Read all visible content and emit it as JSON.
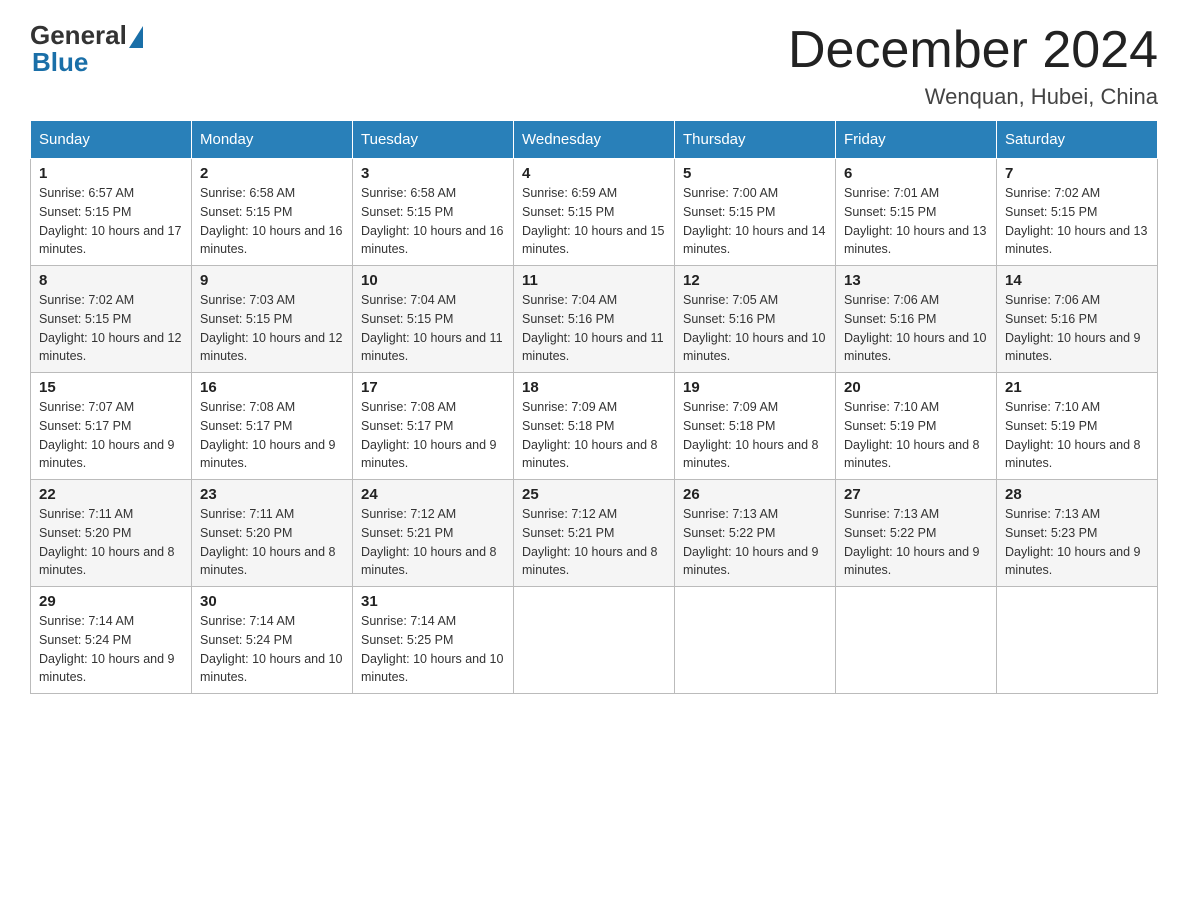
{
  "logo": {
    "general": "General",
    "blue": "Blue"
  },
  "title": "December 2024",
  "location": "Wenquan, Hubei, China",
  "days_of_week": [
    "Sunday",
    "Monday",
    "Tuesday",
    "Wednesday",
    "Thursday",
    "Friday",
    "Saturday"
  ],
  "weeks": [
    [
      {
        "day": "1",
        "sunrise": "6:57 AM",
        "sunset": "5:15 PM",
        "daylight": "10 hours and 17 minutes."
      },
      {
        "day": "2",
        "sunrise": "6:58 AM",
        "sunset": "5:15 PM",
        "daylight": "10 hours and 16 minutes."
      },
      {
        "day": "3",
        "sunrise": "6:58 AM",
        "sunset": "5:15 PM",
        "daylight": "10 hours and 16 minutes."
      },
      {
        "day": "4",
        "sunrise": "6:59 AM",
        "sunset": "5:15 PM",
        "daylight": "10 hours and 15 minutes."
      },
      {
        "day": "5",
        "sunrise": "7:00 AM",
        "sunset": "5:15 PM",
        "daylight": "10 hours and 14 minutes."
      },
      {
        "day": "6",
        "sunrise": "7:01 AM",
        "sunset": "5:15 PM",
        "daylight": "10 hours and 13 minutes."
      },
      {
        "day": "7",
        "sunrise": "7:02 AM",
        "sunset": "5:15 PM",
        "daylight": "10 hours and 13 minutes."
      }
    ],
    [
      {
        "day": "8",
        "sunrise": "7:02 AM",
        "sunset": "5:15 PM",
        "daylight": "10 hours and 12 minutes."
      },
      {
        "day": "9",
        "sunrise": "7:03 AM",
        "sunset": "5:15 PM",
        "daylight": "10 hours and 12 minutes."
      },
      {
        "day": "10",
        "sunrise": "7:04 AM",
        "sunset": "5:15 PM",
        "daylight": "10 hours and 11 minutes."
      },
      {
        "day": "11",
        "sunrise": "7:04 AM",
        "sunset": "5:16 PM",
        "daylight": "10 hours and 11 minutes."
      },
      {
        "day": "12",
        "sunrise": "7:05 AM",
        "sunset": "5:16 PM",
        "daylight": "10 hours and 10 minutes."
      },
      {
        "day": "13",
        "sunrise": "7:06 AM",
        "sunset": "5:16 PM",
        "daylight": "10 hours and 10 minutes."
      },
      {
        "day": "14",
        "sunrise": "7:06 AM",
        "sunset": "5:16 PM",
        "daylight": "10 hours and 9 minutes."
      }
    ],
    [
      {
        "day": "15",
        "sunrise": "7:07 AM",
        "sunset": "5:17 PM",
        "daylight": "10 hours and 9 minutes."
      },
      {
        "day": "16",
        "sunrise": "7:08 AM",
        "sunset": "5:17 PM",
        "daylight": "10 hours and 9 minutes."
      },
      {
        "day": "17",
        "sunrise": "7:08 AM",
        "sunset": "5:17 PM",
        "daylight": "10 hours and 9 minutes."
      },
      {
        "day": "18",
        "sunrise": "7:09 AM",
        "sunset": "5:18 PM",
        "daylight": "10 hours and 8 minutes."
      },
      {
        "day": "19",
        "sunrise": "7:09 AM",
        "sunset": "5:18 PM",
        "daylight": "10 hours and 8 minutes."
      },
      {
        "day": "20",
        "sunrise": "7:10 AM",
        "sunset": "5:19 PM",
        "daylight": "10 hours and 8 minutes."
      },
      {
        "day": "21",
        "sunrise": "7:10 AM",
        "sunset": "5:19 PM",
        "daylight": "10 hours and 8 minutes."
      }
    ],
    [
      {
        "day": "22",
        "sunrise": "7:11 AM",
        "sunset": "5:20 PM",
        "daylight": "10 hours and 8 minutes."
      },
      {
        "day": "23",
        "sunrise": "7:11 AM",
        "sunset": "5:20 PM",
        "daylight": "10 hours and 8 minutes."
      },
      {
        "day": "24",
        "sunrise": "7:12 AM",
        "sunset": "5:21 PM",
        "daylight": "10 hours and 8 minutes."
      },
      {
        "day": "25",
        "sunrise": "7:12 AM",
        "sunset": "5:21 PM",
        "daylight": "10 hours and 8 minutes."
      },
      {
        "day": "26",
        "sunrise": "7:13 AM",
        "sunset": "5:22 PM",
        "daylight": "10 hours and 9 minutes."
      },
      {
        "day": "27",
        "sunrise": "7:13 AM",
        "sunset": "5:22 PM",
        "daylight": "10 hours and 9 minutes."
      },
      {
        "day": "28",
        "sunrise": "7:13 AM",
        "sunset": "5:23 PM",
        "daylight": "10 hours and 9 minutes."
      }
    ],
    [
      {
        "day": "29",
        "sunrise": "7:14 AM",
        "sunset": "5:24 PM",
        "daylight": "10 hours and 9 minutes."
      },
      {
        "day": "30",
        "sunrise": "7:14 AM",
        "sunset": "5:24 PM",
        "daylight": "10 hours and 10 minutes."
      },
      {
        "day": "31",
        "sunrise": "7:14 AM",
        "sunset": "5:25 PM",
        "daylight": "10 hours and 10 minutes."
      },
      null,
      null,
      null,
      null
    ]
  ]
}
